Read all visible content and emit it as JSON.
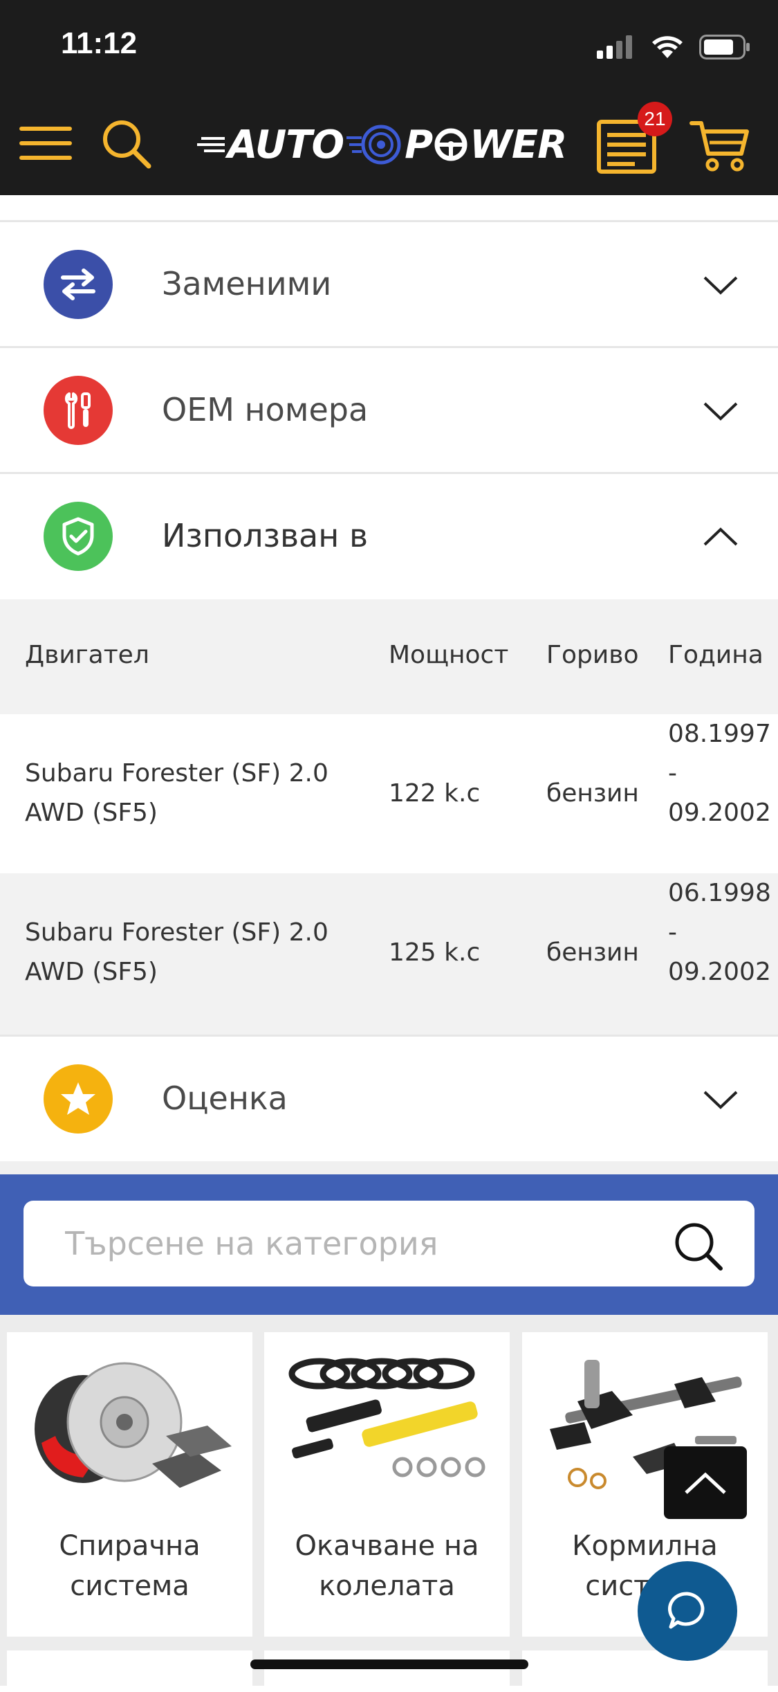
{
  "status_bar": {
    "time": "11:12"
  },
  "header": {
    "logo_text_1": "AUTO",
    "logo_text_2": "P",
    "logo_text_3": "WER",
    "badge_count": "21",
    "brand_color": "#f5b52e",
    "bg_color": "#1c1c1c"
  },
  "accordion": {
    "items": [
      {
        "label": "Заменими",
        "icon": "swap-arrows-icon",
        "color": "#3b4fa8",
        "expanded": false
      },
      {
        "label": "OEM номера",
        "icon": "tools-icon",
        "color": "#e53935",
        "expanded": false
      },
      {
        "label": "Използван в",
        "icon": "shield-check-icon",
        "color": "#4cc25a",
        "expanded": true
      },
      {
        "label": "Оценка",
        "icon": "star-icon",
        "color": "#f5b20f",
        "expanded": false
      }
    ]
  },
  "usage_table": {
    "headers": [
      "Двигател",
      "Мощност",
      "Гориво",
      "Година"
    ],
    "rows": [
      {
        "engine_1": "Subaru Forester (SF) 2.0",
        "engine_2": "AWD (SF5)",
        "power": "122 k.c",
        "fuel": "бензин",
        "year_1": "08.1997",
        "year_2": "-",
        "year_3": "09.2002"
      },
      {
        "engine_1": "Subaru Forester (SF) 2.0",
        "engine_2": "AWD (SF5)",
        "power": "125 k.c",
        "fuel": "бензин",
        "year_1": "06.1998",
        "year_2": "-",
        "year_3": "09.2002"
      }
    ]
  },
  "category_search": {
    "placeholder": "Търсене на категория",
    "band_color": "#4060b5"
  },
  "categories": [
    {
      "name": "Спирачна\nсистема",
      "icon": "brake-disc-icon"
    },
    {
      "name": "Окачване на\nколелата",
      "icon": "suspension-spring-icon"
    },
    {
      "name": "Кормилна\nсистема",
      "icon": "steering-rack-icon"
    }
  ]
}
